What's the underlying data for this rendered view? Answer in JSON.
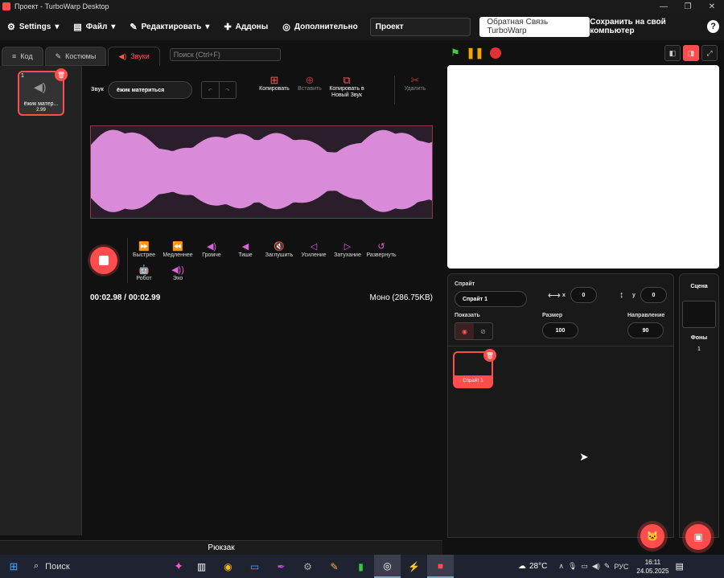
{
  "window": {
    "title": "Проект - TurboWarp Desktop"
  },
  "menu": {
    "settings": "Settings",
    "file": "Файл",
    "edit": "Редактировать",
    "addons": "Аддоны",
    "advanced": "Дополнительно",
    "project_title": "Проект",
    "feedback": "Обратная Связь TurboWarp",
    "save_to_computer": "Сохранить на свой компьютер",
    "help": "?"
  },
  "tabs": [
    {
      "label": "Код"
    },
    {
      "label": "Костюмы"
    },
    {
      "label": "Звуки"
    }
  ],
  "search": {
    "placeholder": "Поиск (Ctrl+F)"
  },
  "sound_list": [
    {
      "index": "1",
      "name": "ёжик матер...",
      "duration": "2.99"
    }
  ],
  "sound_editor": {
    "sound_label": "Звук",
    "sound_name": "ёжик материться",
    "copy": "Копировать",
    "paste": "Вставить",
    "copy_new": "Копировать в Новый Звук",
    "delete": "Удалить",
    "effects": [
      {
        "label": "Быстрее",
        "icon": "faster-icon"
      },
      {
        "label": "Медленнее",
        "icon": "slower-icon"
      },
      {
        "label": "Громче",
        "icon": "louder-icon"
      },
      {
        "label": "Тише",
        "icon": "softer-icon"
      },
      {
        "label": "Заглушить",
        "icon": "mute-icon"
      },
      {
        "label": "Усиление",
        "icon": "fade-in-icon"
      },
      {
        "label": "Затухание",
        "icon": "fade-out-icon"
      },
      {
        "label": "Развернуть",
        "icon": "reverse-icon"
      },
      {
        "label": "Робот",
        "icon": "robot-icon"
      },
      {
        "label": "Эхо",
        "icon": "echo-icon"
      }
    ],
    "time": "00:02.98 / 00:02.99",
    "format": "Моно (286.75KB)",
    "waveform_color": "#d98ad9"
  },
  "backpack": "Рюкзак",
  "sprite_info": {
    "sprite_label": "Спрайт",
    "sprite_name": "Спрайт 1",
    "x_label": "x",
    "x": "0",
    "y_label": "y",
    "y": "0",
    "show_label": "Показать",
    "size_label": "Размер",
    "size": "100",
    "direction_label": "Направление",
    "direction": "90"
  },
  "sprites": [
    {
      "name": "Спрайт 1"
    }
  ],
  "scene": {
    "title": "Сцена",
    "backdrops_label": "Фоны",
    "backdrops_count": "1"
  },
  "taskbar": {
    "search": "Поиск",
    "temperature": "28°C",
    "language": "РУС",
    "time": "16:11",
    "date": "24.05.2025"
  },
  "colors": {
    "accent": "#ff4c4c",
    "background": "#111111"
  }
}
